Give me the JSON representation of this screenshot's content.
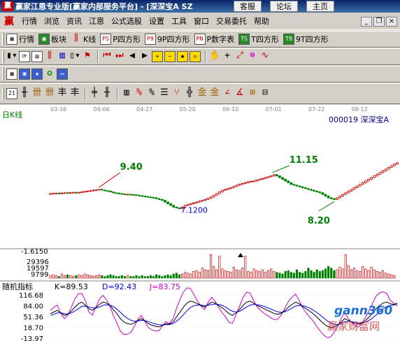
{
  "window": {
    "title": "赢家江恩专业版[赢家内部服务平台] - [深深宝A  SZ",
    "buttons": [
      "客服",
      "论坛",
      "主页"
    ]
  },
  "menu": {
    "items": [
      "行情",
      "浏览",
      "资讯",
      "江恩",
      "公式选股",
      "设置",
      "工具",
      "窗口",
      "交易委托",
      "帮助"
    ]
  },
  "toolbar1": {
    "items": [
      {
        "icon": "table-icon",
        "label": "行情"
      },
      {
        "icon": "blocks-icon",
        "label": "板块"
      },
      {
        "icon": "kline-icon",
        "label": "K线"
      },
      {
        "icon": "p-square-icon",
        "glyph": "PS",
        "label": "P四方形"
      },
      {
        "icon": "p9-square-icon",
        "glyph": "P9",
        "label": "9P四方形"
      },
      {
        "icon": "pn-table-icon",
        "glyph": "PN",
        "label": "P数字表"
      },
      {
        "icon": "t-square-icon",
        "glyph": "TS",
        "label": "T四方形"
      },
      {
        "icon": "t9-square-icon",
        "glyph": "T9",
        "label": "9T四方形"
      }
    ]
  },
  "chart": {
    "period_label": "日K线",
    "stock_label": "000019  深深宝A",
    "date_ticks": [
      "03-16",
      "04-06",
      "04-27",
      "05-20",
      "06-10",
      "07-01",
      "07-22",
      "08-12"
    ],
    "annotations": {
      "high1": "9.40",
      "low1": "7.1200",
      "high2": "11.15",
      "low2": "8.20"
    },
    "volume_axis": [
      "-1.6150",
      "29396",
      "19597",
      "9799"
    ],
    "indicator": {
      "name": "随机指标",
      "k": "K=89.53",
      "d": "D=92.43",
      "j": "J=83.75",
      "axis": [
        "116.68",
        "84.00",
        "51.36",
        "18.70",
        "-13.97"
      ]
    },
    "watermark": {
      "site": "gann360",
      "cn": "赢家财富网"
    },
    "colors": {
      "up": "#cc0000",
      "down": "#008000",
      "k": "#000000",
      "d": "#0000ff",
      "j": "#cc00cc",
      "label": "#008000",
      "ann": "#008000"
    },
    "closes": [
      8.9,
      8.92,
      8.95,
      8.9,
      8.97,
      9.0,
      8.95,
      9.02,
      9.05,
      9.0,
      9.05,
      9.1,
      9.15,
      9.2,
      9.25,
      9.3,
      9.35,
      9.4,
      9.32,
      9.25,
      9.2,
      9.1,
      9.0,
      8.95,
      8.9,
      8.85,
      8.8,
      8.82,
      8.78,
      8.75,
      8.7,
      8.65,
      8.6,
      8.55,
      8.5,
      8.45,
      8.4,
      8.3,
      8.2,
      8.1,
      7.9,
      7.7,
      7.5,
      7.3,
      7.2,
      7.12,
      7.3,
      7.5,
      7.6,
      7.7,
      7.8,
      7.9,
      8.0,
      8.1,
      8.2,
      8.35,
      8.5,
      8.7,
      8.9,
      9.1,
      9.3,
      9.4,
      9.5,
      9.6,
      9.75,
      9.9,
      10.0,
      10.1,
      10.2,
      10.3,
      10.35,
      10.4,
      10.5,
      10.6,
      10.7,
      10.8,
      10.9,
      11.0,
      11.15,
      11.0,
      10.8,
      10.6,
      10.4,
      10.2,
      10.0,
      9.9,
      9.8,
      9.7,
      9.6,
      9.5,
      9.4,
      9.3,
      9.2,
      9.1,
      9.0,
      8.8,
      8.6,
      8.4,
      8.3,
      8.2,
      8.4,
      8.6,
      8.8,
      9.0,
      9.2,
      9.4,
      9.6,
      9.8,
      10.0,
      10.2,
      10.4,
      10.6,
      10.8,
      11.0,
      11.2,
      11.4,
      11.6,
      11.8,
      12.0,
      12.2,
      12.4,
      12.55
    ],
    "volumes": [
      3,
      4,
      3,
      2,
      5,
      3,
      4,
      3,
      2,
      3,
      4,
      3,
      5,
      4,
      3,
      2,
      3,
      4,
      3,
      2,
      3,
      4,
      3,
      2,
      2,
      3,
      2,
      3,
      2,
      2,
      3,
      2,
      3,
      2,
      2,
      3,
      2,
      4,
      3,
      2,
      3,
      4,
      3,
      5,
      6,
      4,
      5,
      7,
      6,
      5,
      8,
      9,
      7,
      12,
      10,
      9,
      28,
      14,
      10,
      26,
      11,
      9,
      8,
      7,
      13,
      10,
      9,
      12,
      26,
      8,
      7,
      11,
      9,
      8,
      10,
      7,
      9,
      11,
      8,
      7,
      6,
      5,
      8,
      9,
      7,
      6,
      10,
      7,
      6,
      8,
      12,
      9,
      7,
      10,
      8,
      9,
      11,
      14,
      12,
      9,
      10,
      13,
      11,
      28,
      15,
      10,
      12,
      9,
      8,
      14,
      11,
      9,
      13,
      10,
      8,
      7,
      9,
      6,
      5,
      4,
      3
    ],
    "k_values": [
      60,
      65,
      70,
      62,
      55,
      58,
      68,
      80,
      90,
      95,
      85,
      75,
      70,
      78,
      88,
      95,
      92,
      85,
      72,
      60,
      45,
      35,
      30,
      28,
      32,
      40,
      45,
      38,
      30,
      25,
      22,
      20,
      25,
      30,
      28,
      35,
      50,
      65,
      80,
      92,
      98,
      95,
      90,
      85,
      80,
      88,
      95,
      92,
      85,
      78,
      70,
      60,
      55,
      62,
      72,
      85,
      95,
      98,
      92,
      85,
      80,
      75,
      70,
      65,
      60,
      58,
      62,
      70,
      80,
      88,
      95,
      90,
      82,
      75,
      68,
      60,
      50,
      40,
      30,
      22,
      18,
      20,
      25,
      35,
      45,
      40,
      35,
      30,
      28,
      32,
      40,
      50,
      62,
      75,
      85,
      92,
      95,
      90,
      88,
      89.53
    ],
    "d_values": [
      55,
      58,
      62,
      63,
      60,
      59,
      62,
      68,
      75,
      82,
      83,
      80,
      77,
      77,
      80,
      85,
      87,
      86,
      81,
      74,
      64,
      54,
      46,
      40,
      37,
      38,
      40,
      39,
      36,
      32,
      29,
      26,
      26,
      27,
      27,
      30,
      37,
      46,
      57,
      69,
      79,
      84,
      86,
      86,
      84,
      85,
      88,
      89,
      88,
      85,
      80,
      73,
      67,
      65,
      67,
      73,
      80,
      86,
      88,
      87,
      85,
      82,
      78,
      74,
      69,
      65,
      64,
      66,
      71,
      77,
      83,
      85,
      84,
      81,
      77,
      71,
      64,
      56,
      47,
      39,
      32,
      28,
      27,
      30,
      35,
      37,
      36,
      34,
      32,
      32,
      35,
      40,
      47,
      56,
      66,
      75,
      82,
      85,
      86,
      92.43
    ],
    "j_values": [
      70,
      79,
      86,
      60,
      45,
      56,
      80,
      104,
      120,
      121,
      99,
      65,
      56,
      80,
      104,
      115,
      102,
      83,
      54,
      32,
      7,
      -3,
      -2,
      4,
      22,
      44,
      55,
      36,
      18,
      11,
      8,
      8,
      23,
      36,
      30,
      45,
      76,
      103,
      126,
      138,
      136,
      117,
      98,
      83,
      72,
      94,
      109,
      98,
      79,
      64,
      50,
      34,
      31,
      56,
      82,
      109,
      125,
      122,
      100,
      81,
      70,
      61,
      54,
      47,
      42,
      44,
      58,
      78,
      98,
      110,
      119,
      100,
      78,
      63,
      50,
      38,
      22,
      8,
      -4,
      -12,
      -10,
      4,
      21,
      45,
      65,
      46,
      33,
      22,
      20,
      32,
      50,
      70,
      92,
      113,
      123,
      126,
      121,
      100,
      92,
      83.75
    ]
  }
}
